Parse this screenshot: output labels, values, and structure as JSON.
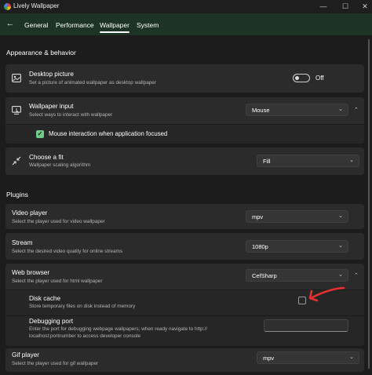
{
  "window": {
    "title": "Lively Wallpaper",
    "minimize": "—",
    "maximize": "☐",
    "close": "✕"
  },
  "nav": {
    "back": "←",
    "tabs": [
      {
        "label": "General"
      },
      {
        "label": "Performance"
      },
      {
        "label": "Wallpaper",
        "active": true
      },
      {
        "label": "System"
      }
    ]
  },
  "appearance": {
    "section_title": "Appearance & behavior",
    "desktop_picture": {
      "title": "Desktop picture",
      "description": "Set a picture of animated wallpaper as desktop wallpaper",
      "toggle_state": "Off"
    },
    "wallpaper_input": {
      "title": "Wallpaper input",
      "description": "Select ways to interact with wallpaper",
      "selected": "Mouse",
      "mouse_focus_label": "Mouse interaction when application focused"
    },
    "choose_fit": {
      "title": "Choose a fit",
      "description": "Wallpaper scaling algorithm",
      "selected": "Fill"
    }
  },
  "plugins": {
    "section_title": "Plugins",
    "video_player": {
      "title": "Video player",
      "description": "Select the player used for video wallpaper",
      "selected": "mpv"
    },
    "stream": {
      "title": "Stream",
      "description": "Select the desired video quality for online streams",
      "selected": "1080p"
    },
    "web_browser": {
      "title": "Web browser",
      "description": "Select the player used for html wallpaper",
      "selected": "CefSharp",
      "disk_cache": {
        "title": "Disk cache",
        "description": "Store temporary files on disk instead of memory"
      },
      "debugging_port": {
        "title": "Debugging port",
        "description_line1": "Enter the port for debugging webpage wallpapers; when ready navigate to http://",
        "description_line2": "localhost:portnumber to access developer console",
        "value": ""
      }
    },
    "gif_player": {
      "title": "Gif player",
      "description": "Select the player used for gif wallpaper",
      "selected": "mpv"
    }
  },
  "annotation": {
    "color": "#e8312f"
  },
  "colors": {
    "accent_green": "#6fcb8a",
    "nav_background": "#1d3324",
    "card_background": "#2b2b2b"
  }
}
